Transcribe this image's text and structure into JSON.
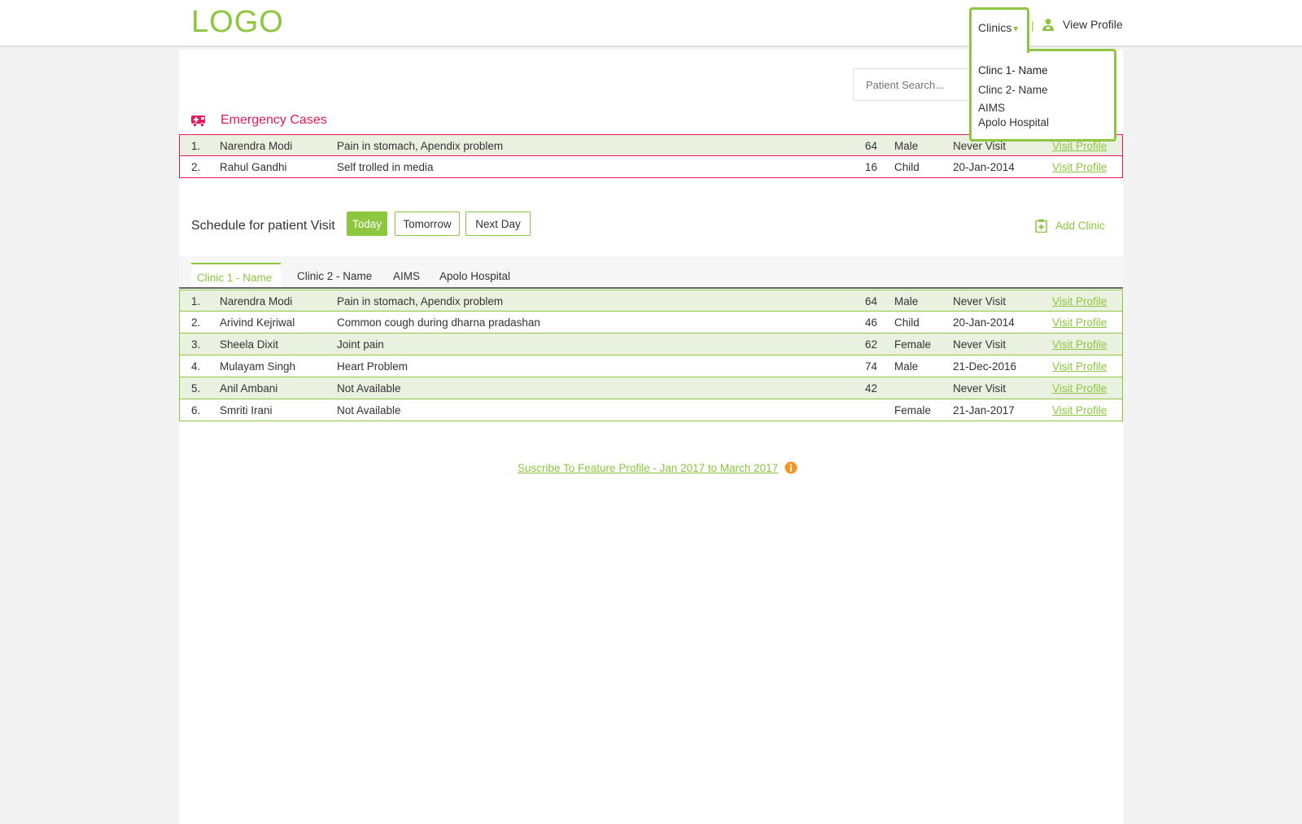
{
  "header": {
    "logo": "LOGO",
    "clinics_label": "Clinics",
    "clinics_caret": "▾",
    "separator": "|",
    "view_profile": "View Profile"
  },
  "clinics_dropdown": {
    "items": [
      "Clinc 1- Name",
      "Clinc 2- Name",
      "AIMS",
      "Apolo Hospital"
    ]
  },
  "search": {
    "placeholder": "Patient Search..."
  },
  "emergency": {
    "title": "Emergency Cases",
    "rows": [
      {
        "num": "1.",
        "name": "Narendra Modi",
        "desc": "Pain in stomach, Apendix problem",
        "age": "64",
        "sex": "Male",
        "last": "Never Visit",
        "link": "Visit Profile"
      },
      {
        "num": "2.",
        "name": "Rahul Gandhi",
        "desc": "Self trolled in media",
        "age": "16",
        "sex": "Child",
        "last": "20-Jan-2014",
        "link": "Visit Profile"
      }
    ]
  },
  "schedule": {
    "label": "Schedule for patient Visit",
    "buttons": [
      "Today",
      "Tomorrow",
      "Next Day"
    ],
    "add_clinic": "Add Clinic",
    "tabs": [
      "Clinic 1 - Name",
      "Clinic 2 - Name",
      "AIMS",
      "Apolo Hospital"
    ],
    "rows": [
      {
        "num": "1.",
        "name": "Narendra Modi",
        "desc": "Pain in stomach, Apendix problem",
        "age": "64",
        "sex": "Male",
        "last": "Never Visit",
        "link": "Visit Profile"
      },
      {
        "num": "2.",
        "name": "Arivind Kejriwal",
        "desc": "Common cough during dharna pradashan",
        "age": "46",
        "sex": "Child",
        "last": "20-Jan-2014",
        "link": "Visit Profile"
      },
      {
        "num": "3.",
        "name": "Sheela Dixit",
        "desc": "Joint pain",
        "age": "62",
        "sex": "Female",
        "last": "Never Visit",
        "link": "Visit Profile"
      },
      {
        "num": "4.",
        "name": "Mulayam Singh",
        "desc": "Heart Problem",
        "age": "74",
        "sex": "Male",
        "last": "21-Dec-2016",
        "link": "Visit Profile"
      },
      {
        "num": "5.",
        "name": "Anil Ambani",
        "desc": "Not Available",
        "age": "42",
        "sex": "",
        "last": "Never Visit",
        "link": "Visit Profile"
      },
      {
        "num": "6.",
        "name": "Smriti Irani",
        "desc": "Not Available",
        "age": "",
        "sex": "Female",
        "last": "21-Jan-2017",
        "link": "Visit Profile"
      }
    ]
  },
  "footer": {
    "subscribe": "Suscribe To Feature Profile - Jan 2017 to March 2017"
  },
  "icons": {
    "ambulance": "ambulance-icon",
    "user": "user-icon",
    "clipboard": "clipboard-icon",
    "info": "info-icon"
  },
  "colors": {
    "accent": "#8dc63f",
    "emergency": "#e8195a",
    "row_shade": "#eaf1e1",
    "info": "#f7941d"
  }
}
